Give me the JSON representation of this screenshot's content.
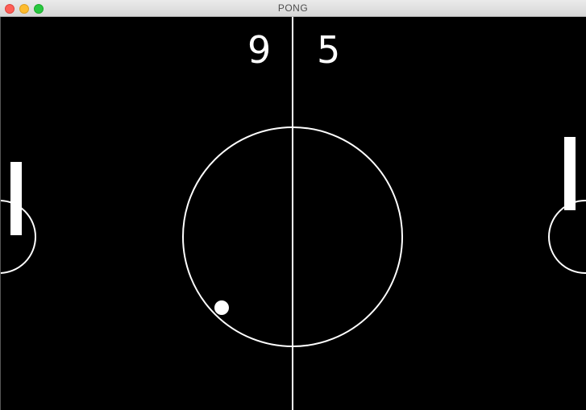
{
  "window": {
    "title": "PONG"
  },
  "scores": {
    "left": "9",
    "right": "5"
  },
  "colors": {
    "court": "#000000",
    "lines": "#ffffff",
    "close": "#fe5f57",
    "minimize": "#febc2e",
    "zoom": "#28c840"
  }
}
